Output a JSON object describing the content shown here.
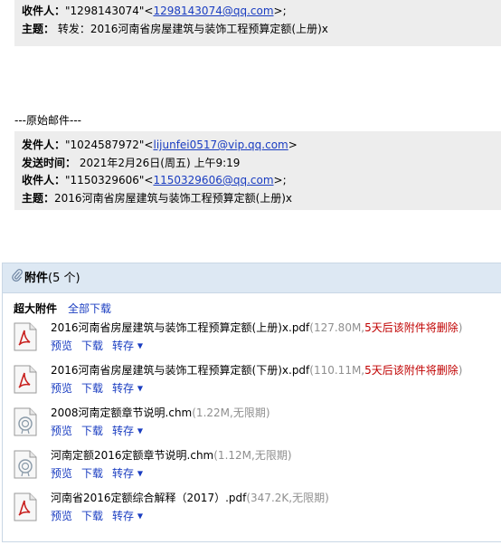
{
  "forward_header": {
    "to_label": "收件人",
    "to_name": "\"1298143074\"",
    "to_email": "1298143074@qq.com",
    "to_suffix": ">;",
    "subject_label": "主题",
    "subject": "转发：2016河南省房屋建筑与装饰工程预算定额(上册)x"
  },
  "original_divider": "---原始邮件---",
  "original_header": {
    "from_label": "发件人",
    "from_name": "\"1024587972\"",
    "from_email": "lijunfei0517@vip.qq.com",
    "from_suffix": ">",
    "sent_label": "发送时间",
    "sent_value": "2021年2月26日(周五) 上午9:19",
    "to_label": "收件人",
    "to_name": "\"1150329606\"",
    "to_email": "1150329606@qq.com",
    "to_suffix": ">;",
    "subject_label": "主题",
    "subject": "2016河南省房屋建筑与装饰工程预算定额(上册)x"
  },
  "attachments": {
    "title": "附件",
    "count": "(5 个)",
    "large_label": "超大附件",
    "download_all": "全部下载",
    "actions": {
      "preview": "预览",
      "download": "下载",
      "forward": "转存"
    },
    "items": [
      {
        "name": "2016河南省房屋建筑与装饰工程预算定额(上册)x.pdf",
        "size": "(127.80M,",
        "warn": "5天后该附件将删除",
        "close": ")",
        "icon": "pdf-icon"
      },
      {
        "name": "2016河南省房屋建筑与装饰工程预算定额(下册)x.pdf",
        "size": "(110.11M,",
        "warn": "5天后该附件将删除",
        "close": ")",
        "icon": "pdf-icon"
      },
      {
        "name": "2008河南定额章节说明.chm",
        "size": "(1.22M,无限期)",
        "warn": "",
        "close": "",
        "icon": "chm-icon"
      },
      {
        "name": "河南定额2016定额章节说明.chm",
        "size": "(1.12M,无限期)",
        "warn": "",
        "close": "",
        "icon": "chm-icon"
      },
      {
        "name": "河南省2016定额综合解释（2017）.pdf",
        "size": "(347.2K,无限期)",
        "warn": "",
        "close": "",
        "icon": "pdf-icon"
      }
    ]
  },
  "colors": {
    "header_bg": "#ededed",
    "link": "#1a3dc1",
    "panel_head_bg": "#dde8f3",
    "warn": "#c00000",
    "meta": "#8f8f8f"
  }
}
